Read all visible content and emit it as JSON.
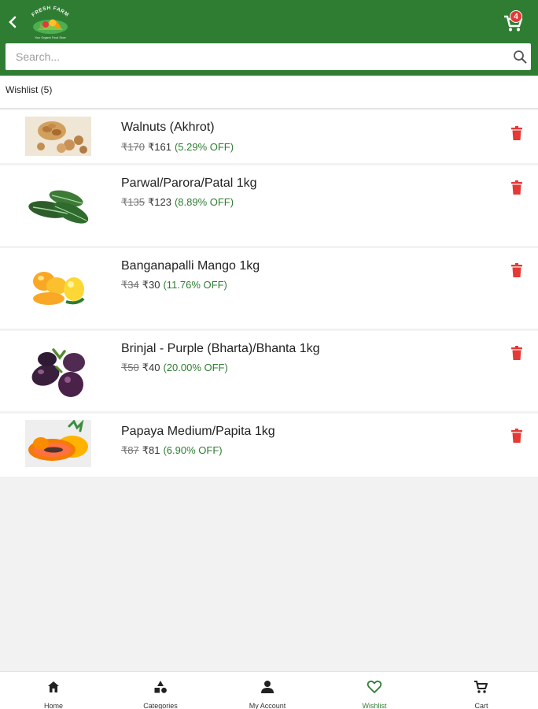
{
  "header": {
    "back_icon": "chevron-left-icon",
    "logo_text": "FRESH FARM",
    "logo_tagline": "Your Organic Food Store",
    "cart_icon": "cart-icon",
    "cart_count": "4"
  },
  "search": {
    "placeholder": "Search...",
    "value": "",
    "icon": "search-icon"
  },
  "wishlist": {
    "title": "Wishlist (5)"
  },
  "items": [
    {
      "name": "Walnuts (Akhrot)",
      "old_price": "₹170",
      "new_price": "₹161",
      "discount": "(5.29% OFF)",
      "image": "walnuts-image"
    },
    {
      "name": "Parwal/Parora/Patal 1kg",
      "old_price": "₹135",
      "new_price": "₹123",
      "discount": "(8.89% OFF)",
      "image": "parwal-image"
    },
    {
      "name": "Banganapalli Mango 1kg",
      "old_price": "₹34",
      "new_price": "₹30",
      "discount": "(11.76% OFF)",
      "image": "mango-image"
    },
    {
      "name": "Brinjal - Purple (Bharta)/Bhanta 1kg",
      "old_price": "₹50",
      "new_price": "₹40",
      "discount": "(20.00% OFF)",
      "image": "brinjal-image"
    },
    {
      "name": "Papaya Medium/Papita 1kg",
      "old_price": "₹87",
      "new_price": "₹81",
      "discount": "(6.90% OFF)",
      "image": "papaya-image"
    }
  ],
  "colors": {
    "brand": "#2f7d32",
    "discount": "#2e7d32",
    "delete": "#e53935",
    "badge": "#e53935"
  },
  "bottom_nav": [
    {
      "label": "Home",
      "icon": "home-icon",
      "active": false
    },
    {
      "label": "Categories",
      "icon": "categories-icon",
      "active": false
    },
    {
      "label": "My Account",
      "icon": "person-icon",
      "active": false
    },
    {
      "label": "Wishlist",
      "icon": "heart-icon",
      "active": true
    },
    {
      "label": "Cart",
      "icon": "cart-icon",
      "active": false
    }
  ]
}
